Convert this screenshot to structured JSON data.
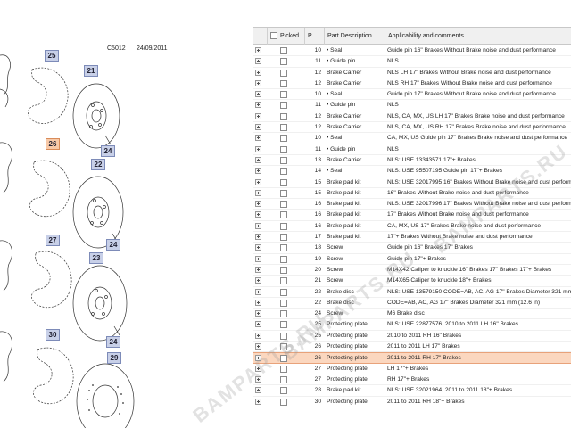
{
  "diagram": {
    "code": "C5012",
    "date": "24/09/2011",
    "callouts": [
      {
        "label": "25",
        "highlighted": false
      },
      {
        "label": "21",
        "highlighted": false
      },
      {
        "label": "24",
        "highlighted": false
      },
      {
        "label": "26",
        "highlighted": true
      },
      {
        "label": "22",
        "highlighted": false
      },
      {
        "label": "24",
        "highlighted": false
      },
      {
        "label": "27",
        "highlighted": false
      },
      {
        "label": "23",
        "highlighted": false
      },
      {
        "label": "24",
        "highlighted": false
      },
      {
        "label": "30",
        "highlighted": false
      },
      {
        "label": "29",
        "highlighted": false
      }
    ]
  },
  "table": {
    "headers": {
      "picked": "Picked",
      "pos": "P...",
      "desc": "Part Description",
      "app": "Applicability and comments"
    },
    "rows": [
      {
        "pos": "10",
        "desc": "• Seal",
        "app": "Guide pin 16\" Brakes Without Brake noise and dust performance"
      },
      {
        "pos": "11",
        "desc": "• Guide pin",
        "app": "NLS"
      },
      {
        "pos": "12",
        "desc": "Brake Carrier",
        "app": "NLS LH 17\" Brakes Without Brake noise and dust performance"
      },
      {
        "pos": "12",
        "desc": "Brake Carrier",
        "app": "NLS RH 17\" Brakes Without Brake noise and dust performance"
      },
      {
        "pos": "10",
        "desc": "• Seal",
        "app": "Guide pin 17\" Brakes Without Brake noise and dust performance"
      },
      {
        "pos": "11",
        "desc": "• Guide pin",
        "app": "NLS"
      },
      {
        "pos": "12",
        "desc": "Brake Carrier",
        "app": "NLS, CA, MX, US LH 17\" Brakes Brake noise and dust performance"
      },
      {
        "pos": "12",
        "desc": "Brake Carrier",
        "app": "NLS, CA, MX, US RH 17\" Brakes Brake noise and dust performance"
      },
      {
        "pos": "10",
        "desc": "• Seal",
        "app": "CA, MX, US Guide pin 17\" Brakes Brake noise and dust performance"
      },
      {
        "pos": "11",
        "desc": "• Guide pin",
        "app": "NLS"
      },
      {
        "pos": "13",
        "desc": "Brake Carrier",
        "app": "NLS: USE 13343571 17\"+ Brakes"
      },
      {
        "pos": "14",
        "desc": "• Seal",
        "app": "NLS: USE 95507195 Guide pin 17\"+ Brakes"
      },
      {
        "pos": "15",
        "desc": "Brake pad kit",
        "app": "NLS: USE 32017995 16\" Brakes Without Brake noise and dust performance"
      },
      {
        "pos": "15",
        "desc": "Brake pad kit",
        "app": "16\" Brakes Without Brake noise and dust performance"
      },
      {
        "pos": "16",
        "desc": "Brake pad kit",
        "app": "NLS: USE 32017996 17\" Brakes Without Brake noise and dust performance"
      },
      {
        "pos": "16",
        "desc": "Brake pad kit",
        "app": "17\" Brakes Without Brake noise and dust performance"
      },
      {
        "pos": "16",
        "desc": "Brake pad kit",
        "app": "CA, MX, US 17\" Brakes Brake noise and dust performance"
      },
      {
        "pos": "17",
        "desc": "Brake pad kit",
        "app": "17\"+ Brakes Without Brake noise and dust performance"
      },
      {
        "pos": "18",
        "desc": "Screw",
        "app": "Guide pin 16\" Brakes 17\" Brakes"
      },
      {
        "pos": "19",
        "desc": "Screw",
        "app": "Guide pin 17\"+ Brakes"
      },
      {
        "pos": "20",
        "desc": "Screw",
        "app": "M14X42 Caliper to knuckle 16\" Brakes 17\" Brakes 17\"+ Brakes"
      },
      {
        "pos": "21",
        "desc": "Screw",
        "app": "M14X65 Caliper to knuckle 18\"+ Brakes"
      },
      {
        "pos": "22",
        "desc": "Brake disc",
        "app": "NLS: USE 13579150 CODE=AB, AC, AG 17\" Brakes Diameter 321 mm"
      },
      {
        "pos": "22",
        "desc": "Brake disc",
        "app": "CODE=AB, AC, AG 17\" Brakes Diameter 321 mm (12.6 in)"
      },
      {
        "pos": "24",
        "desc": "Screw",
        "app": "M6 Brake disc"
      },
      {
        "pos": "25",
        "desc": "Protecting plate",
        "app": "NLS: USE 22877576, 2010 to 2011 LH 16\" Brakes"
      },
      {
        "pos": "25",
        "desc": "Protecting plate",
        "app": "2010 to 2011 RH 16\" Brakes"
      },
      {
        "pos": "26",
        "desc": "Protecting plate",
        "app": "2011 to 2011 LH 17\" Brakes"
      },
      {
        "pos": "26",
        "desc": "Protecting plate",
        "app": "2011 to 2011 RH 17\" Brakes",
        "selected": true
      },
      {
        "pos": "27",
        "desc": "Protecting plate",
        "app": "LH 17\"+ Brakes"
      },
      {
        "pos": "27",
        "desc": "Protecting plate",
        "app": "RH 17\"+ Brakes"
      },
      {
        "pos": "28",
        "desc": "Brake pad kit",
        "app": "NLS: USE 32021964, 2011 to 2011 18\"+ Brakes"
      },
      {
        "pos": "30",
        "desc": "Protecting plate",
        "app": "2011 to 2011 RH 18\"+ Brakes"
      }
    ]
  },
  "watermarks": [
    "BAMPARTS.RU",
    "BAMPARTS.RU",
    "BAMPARTS.RU"
  ],
  "colors": {
    "selected_row": "#fbd7bf",
    "callout": "#c8d0e8",
    "callout_highlight": "#f7c9a8"
  }
}
